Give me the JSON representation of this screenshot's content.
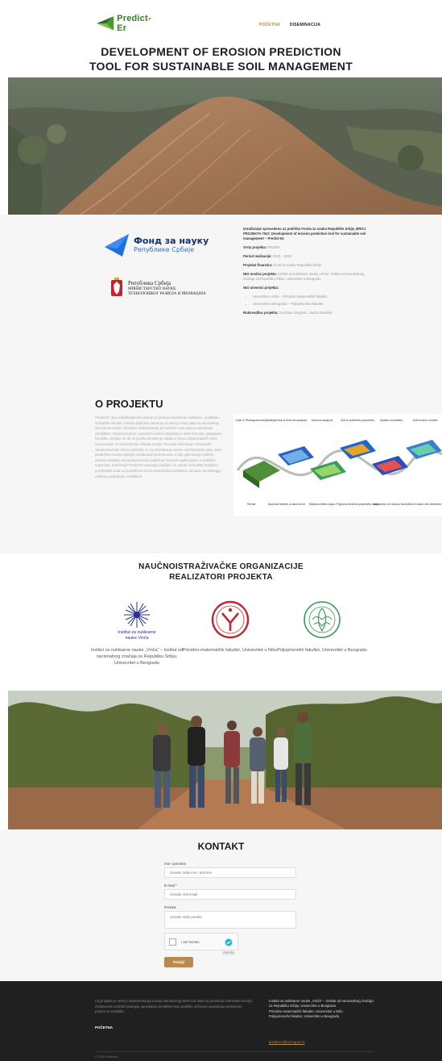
{
  "header": {
    "logo_text": "Predict-Er",
    "nav": [
      {
        "label": "POČETNA",
        "active": true
      },
      {
        "label": "DISEMINACIJA",
        "active": false
      }
    ]
  },
  "hero": {
    "title_line1": "DEVELOPMENT OF EROSION PREDICTION",
    "title_line2": "TOOL FOR SUSTAINABLE SOIL MANAGEMENT"
  },
  "funding": {
    "fond_line1": "Фонд за науку",
    "fond_line2": "Републике Србије",
    "ministry_line1": "Република Србија",
    "ministry_line2": "МИНИСТАРСТВО НАУКЕ,",
    "ministry_line3": "ТЕХНОЛОШКОГ РАЗВОЈА И ИНОВАЦИЈА",
    "intro": "Istraživanje sprovedeno uz podršku Fonda za nauku Republike Srbije, BROJ PROJEKTA 7047, Development of erosion prediction tool for sustainable soil management – Predict-Er.",
    "items": [
      {
        "label": "Vrsta projekta:",
        "value": "PRIZMA"
      },
      {
        "label": "Period realizacije:",
        "value": "2023 – 2026"
      },
      {
        "label": "Projekat finansira:",
        "value": "Fond za nauku Republike Srbije"
      },
      {
        "label": "NIO nosilac projekta:",
        "value": "Institut za nuklearne nauke „Vinča\" institut od nacionalnog značaja za Republiku Srbiju, Univerzitet u Beogradu"
      }
    ],
    "participants_label": "NIO učesnici projekta:",
    "participants": [
      "Univerzitet u Nišu – Prirodno-matematički fakultet",
      "Univerzitet u Beogradu – Poljoprivredni fakultet"
    ],
    "leader_label": "Rukovodilac projekta:",
    "leader_value": "Snežana Dragović, naučni savetnik"
  },
  "about": {
    "title": "O PROJEKTU",
    "text": "Predict-Er ima multidisciplinarni pristup po principu kombinuje nuklearne, analitičke i statističke tehnike i tehnike daljinske detekcije za razvoj novog alata za predviđanje intenziteta erozije i dinamike sedimentacije pri različitim scenarijima upravljanja zemljištem. Reprezentativni i provereni modeli integrisani u Web-GIS alat, prilagođen korisniku, kreiraju se cilj do pružila donošenje odluka u izboru odgovarajućih mera konzervacije za minimiziranje efekata erozije. Ponavlje informacije relevantnih zainteresovanim strana korisnike će za pobeđivanje otozne i performanse alata. Biće predloženi modeli najboljih predikcionih performanse u cilju optimizacije količine ulaznih podataka za parametrizaciju modela pri budućim aplikacijama u različitim regionima. Kombinuje Predict-Er prolonga značajno će utiicati na kvalitet zemljišta i površinskih voda sa posledičnim socio-ekonomskim koristima i ulicajem na strategije održivog upravljanja zemljištem.",
    "diagram_labels": {
      "top": [
        "Lidar & Photogrammetry",
        "Multispectral & thermal analysis",
        "Gamma analysis",
        "Soil & sediment properties",
        "Spatial correlation",
        "Soil erosion models"
      ],
      "bottom": [
        "Terrain",
        "Spectral indices & land cover",
        "Radionuclides maps",
        "Physicochemical properties maps",
        "Interaction of various factors",
        "Soil erosion risk detection"
      ]
    }
  },
  "orgs": {
    "title_line1": "NAUČNOISTRAŽIVAČKE ORGANIZACIJE",
    "title_line2": "REALIZATORI PROJEKTA",
    "vinca_logo_line1": "Institut za nuklearne",
    "vinca_logo_line2": "nauke Vinča",
    "items": [
      {
        "name": "Institut za nuklearne nauke „Vinča\" – institut od nacionalnog značaja za Republiku Srbiju, Univerzitet u Beogradu"
      },
      {
        "name": "Prirodno-matematički fakultet, Univerzitet u Nišu."
      },
      {
        "name": "Poljoprivredni fakultet, Univerzitet u Beogradu"
      }
    ]
  },
  "contact": {
    "title": "KONTAKT",
    "name_label": "Ime i prezime",
    "name_placeholder": "Unesite Vaše ime i prezime",
    "email_label": "E-mail *",
    "email_placeholder": "Unesite Vaš email",
    "message_label": "Poruka",
    "message_placeholder": "Unesite Vašu poruku",
    "captcha_label": "I am human",
    "captcha_brand": "hCaptcha",
    "captcha_terms": "Privacy · Terms",
    "submit_label": "Pošalji"
  },
  "footer": {
    "description": "Cilj projekta je razvoj i implementacija novog interaktivnog Web-GIS alata za predikciju intenziteta erozije i efektivnosti različitih strategija upravljanja zemljištem kao podrške održivom upravljanju prostornim podacima zemljišta.",
    "link": "POČETNA",
    "orgs": [
      "Institut za nuklearne nauke „Vinča\" – institut od nacionalnog značaja za Republiku Srbiju, Univerzitet u Beogradu",
      "Prirodno-matematički fakultet, Univerzitet u Nišu",
      "Poljoprivredni fakultet, Univerzitet u Beogradu"
    ],
    "email": "predict-er@vin.bg.ac.rs",
    "copyright": "© 2024 Predict-Er"
  },
  "colors": {
    "accent": "#b88a4e",
    "footer_bg": "#202020",
    "section_bg": "#f6f6f6",
    "logo_green": "#3d7a2f"
  }
}
